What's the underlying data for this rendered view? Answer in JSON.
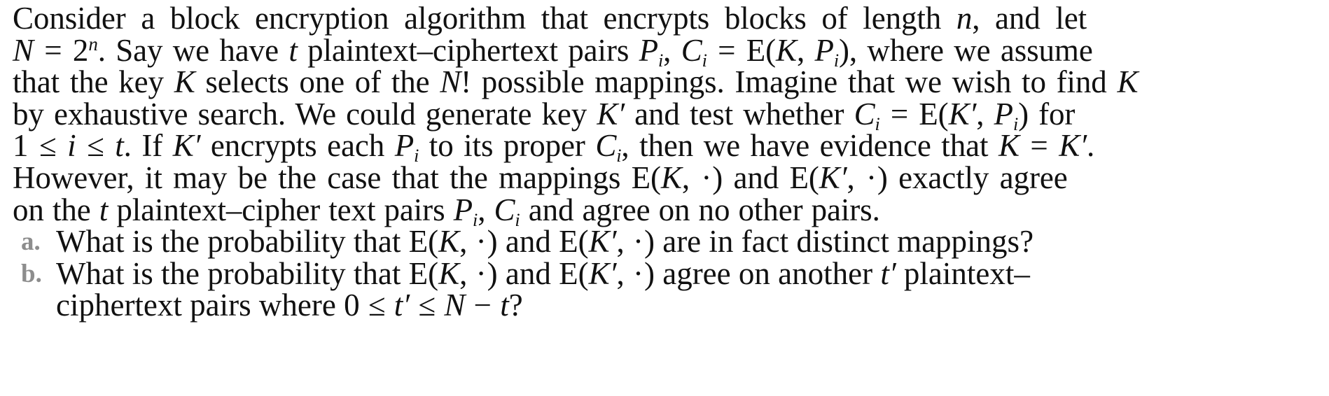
{
  "document": {
    "type": "textbook-exercise",
    "body_color": "#111111",
    "marker_color": "#8d8d8d",
    "background_color": "#ffffff",
    "paragraph": {
      "full_text": "Consider a block encryption algorithm that encrypts blocks of length n, and let N = 2^n. Say we have t plaintext–ciphertext pairs P_i, C_i = E(K, P_i), where we assume that the key K selects one of the N! possible mappings. Imagine that we wish to find K by exhaustive search. We could generate key K' and test whether C_i = E(K', P_i) for 1 ≤ i ≤ t. If K' encrypts each P_i to its proper C_i, then we have evidence that K = K'. However, it may be the case that the mappings E(K, ·) and E(K', ·) exactly agree on the t plaintext–cipher text pairs P_i, C_i and agree on no other pairs.",
      "lines": [
        "Consider a block encryption algorithm that encrypts blocks of length n, and let",
        "N = 2n. Say we have t plaintext–ciphertext pairs Pi, Ci = E(K, Pi), where we assume",
        "that the key K selects one of the N! possible mappings. Imagine that we wish to find K",
        "by exhaustive search. We could generate key K′ and test whether Ci = E(K′, Pi) for",
        "1 ≤ i ≤ t. If K′ encrypts each Pi to its proper Ci, then we have evidence that K = K′.",
        "However, it may be the case that the mappings E(K, ·) and E(K′, ·) exactly agree",
        "on the t plaintext–cipher text pairs Pi, Ci and agree on no other pairs."
      ]
    },
    "questions": [
      {
        "marker": "a.",
        "text": "What is the probability that E(K, ·) and E(K′, ·) are in fact distinct mappings?",
        "lines": [
          "What is the probability that E(K, ·) and E(K′, ·) are in fact distinct mappings?"
        ]
      },
      {
        "marker": "b.",
        "text": "What is the probability that E(K, ·) and E(K′, ·) agree on another t′ plaintext–ciphertext pairs where 0 ≤ t′ ≤ N − t?",
        "lines": [
          "What is the probability that E(K, ·) and E(K′, ·) agree on another t′ plaintext–",
          "ciphertext pairs where 0 ≤ t′ ≤ N − t?"
        ]
      }
    ],
    "symbols": {
      "n": "n",
      "N": "N",
      "two": "2",
      "t": "t",
      "t_prime": "t′",
      "P": "P",
      "C": "C",
      "E": "E",
      "K": "K",
      "K_prime": "K′",
      "i": "i",
      "one": "1",
      "zero": "0",
      "equals": "=",
      "leq": "≤",
      "minus": "−",
      "factorial": "!",
      "dot": "·",
      "endash": "–",
      "comma": ",",
      "period": ".",
      "question": "?",
      "lparen": "(",
      "rparen": ")"
    },
    "words": {
      "consider": "Consider",
      "a": "a",
      "block": "block",
      "encryption": "encryption",
      "algorithm": "algorithm",
      "that": "that",
      "encrypts": "encrypts",
      "blocks": "blocks",
      "of": "of",
      "length": "length",
      "and": "and",
      "let": "let",
      "say": "Say",
      "we": "we",
      "have": "have",
      "plaintext_ciphertext": "plaintext–ciphertext",
      "pairs": "pairs",
      "where": "where",
      "assume": "assume",
      "the": "the",
      "key": "key",
      "selects": "selects",
      "one": "one",
      "possible": "possible",
      "mappings": "mappings",
      "imagine": "Imagine",
      "wish": "wish",
      "to": "to",
      "find": "find",
      "by": "by",
      "exhaustive": "exhaustive",
      "search": "search",
      "we_could": "We",
      "could": "could",
      "generate": "generate",
      "test": "test",
      "whether": "whether",
      "for": "for",
      "if": "If",
      "each": "each",
      "its": "its",
      "proper": "proper",
      "then": "then",
      "evidence": "evidence",
      "however": "However",
      "it": "it",
      "may": "may",
      "be": "be",
      "case": "case",
      "exactly": "exactly",
      "agree": "agree",
      "on": "on",
      "plaintext_cipher": "plaintext–cipher",
      "text": "text",
      "no": "no",
      "other": "other",
      "what": "What",
      "is": "is",
      "probability": "probability",
      "are": "are",
      "in": "in",
      "fact": "fact",
      "distinct": "distinct",
      "another": "another",
      "ciphertext": "ciphertext"
    }
  }
}
